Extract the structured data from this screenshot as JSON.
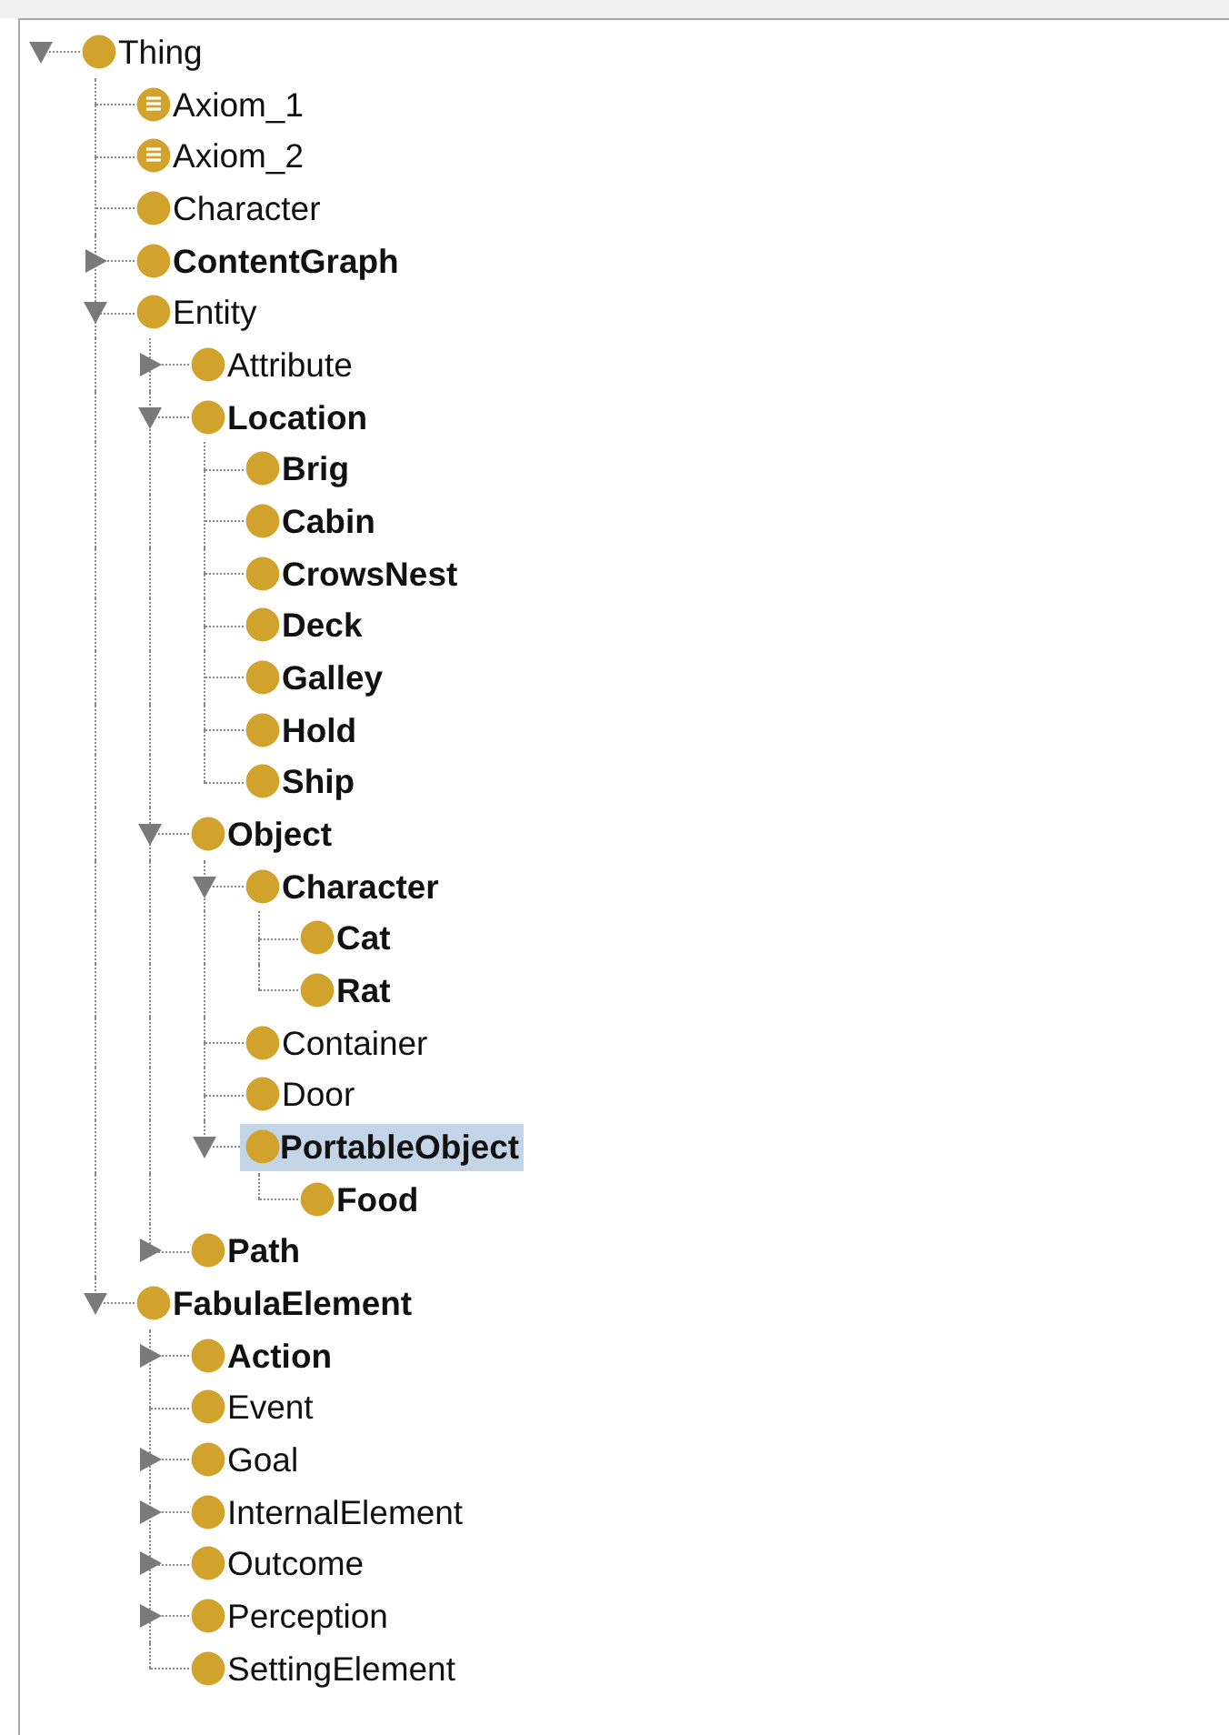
{
  "class_tree": [
    {
      "label": "Thing",
      "kind": "class",
      "bold": false,
      "selected": false,
      "expanded": true,
      "children": [
        {
          "label": "Axiom_1",
          "kind": "axiom",
          "bold": false,
          "selected": false
        },
        {
          "label": "Axiom_2",
          "kind": "axiom",
          "bold": false,
          "selected": false
        },
        {
          "label": "Character",
          "kind": "class",
          "bold": false,
          "selected": false
        },
        {
          "label": "ContentGraph",
          "kind": "class",
          "bold": true,
          "selected": false,
          "expanded": false
        },
        {
          "label": "Entity",
          "kind": "class",
          "bold": false,
          "selected": false,
          "expanded": true,
          "children": [
            {
              "label": "Attribute",
              "kind": "class",
              "bold": false,
              "selected": false,
              "expanded": false
            },
            {
              "label": "Location",
              "kind": "class",
              "bold": true,
              "selected": false,
              "expanded": true,
              "children": [
                {
                  "label": "Brig",
                  "kind": "class",
                  "bold": true,
                  "selected": false
                },
                {
                  "label": "Cabin",
                  "kind": "class",
                  "bold": true,
                  "selected": false
                },
                {
                  "label": "CrowsNest",
                  "kind": "class",
                  "bold": true,
                  "selected": false
                },
                {
                  "label": "Deck",
                  "kind": "class",
                  "bold": true,
                  "selected": false
                },
                {
                  "label": "Galley",
                  "kind": "class",
                  "bold": true,
                  "selected": false
                },
                {
                  "label": "Hold",
                  "kind": "class",
                  "bold": true,
                  "selected": false
                },
                {
                  "label": "Ship",
                  "kind": "class",
                  "bold": true,
                  "selected": false
                }
              ]
            },
            {
              "label": "Object",
              "kind": "class",
              "bold": true,
              "selected": false,
              "expanded": true,
              "children": [
                {
                  "label": "Character",
                  "kind": "class",
                  "bold": true,
                  "selected": false,
                  "expanded": true,
                  "children": [
                    {
                      "label": "Cat",
                      "kind": "class",
                      "bold": true,
                      "selected": false
                    },
                    {
                      "label": "Rat",
                      "kind": "class",
                      "bold": true,
                      "selected": false
                    }
                  ]
                },
                {
                  "label": "Container",
                  "kind": "class",
                  "bold": false,
                  "selected": false
                },
                {
                  "label": "Door",
                  "kind": "class",
                  "bold": false,
                  "selected": false
                },
                {
                  "label": "PortableObject",
                  "kind": "class",
                  "bold": true,
                  "selected": true,
                  "expanded": true,
                  "children": [
                    {
                      "label": "Food",
                      "kind": "class",
                      "bold": true,
                      "selected": false
                    }
                  ]
                }
              ]
            },
            {
              "label": "Path",
              "kind": "class",
              "bold": true,
              "selected": false,
              "expanded": false
            }
          ]
        },
        {
          "label": "FabulaElement",
          "kind": "class",
          "bold": true,
          "selected": false,
          "expanded": true,
          "children": [
            {
              "label": "Action",
              "kind": "class",
              "bold": true,
              "selected": false,
              "expanded": false
            },
            {
              "label": "Event",
              "kind": "class",
              "bold": false,
              "selected": false
            },
            {
              "label": "Goal",
              "kind": "class",
              "bold": false,
              "selected": false,
              "expanded": false
            },
            {
              "label": "InternalElement",
              "kind": "class",
              "bold": false,
              "selected": false,
              "expanded": false
            },
            {
              "label": "Outcome",
              "kind": "class",
              "bold": false,
              "selected": false,
              "expanded": false
            },
            {
              "label": "Perception",
              "kind": "class",
              "bold": false,
              "selected": false,
              "expanded": false
            },
            {
              "label": "SettingElement",
              "kind": "class",
              "bold": false,
              "selected": false
            }
          ]
        }
      ]
    }
  ]
}
